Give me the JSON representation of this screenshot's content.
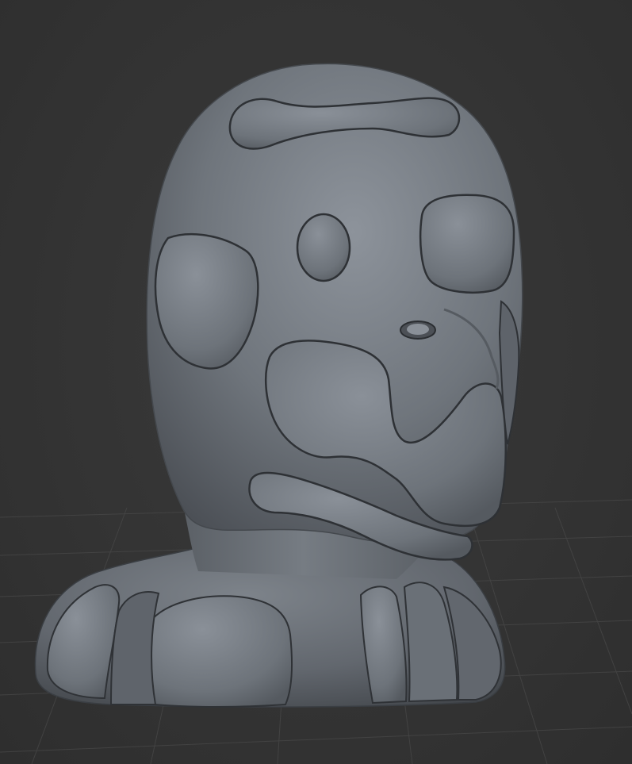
{
  "viewport": {
    "background_color": "#343434",
    "grid_color": "#4a4a4a",
    "model_base_color": "#6e737a",
    "model_highlight_color": "#9aa0a8",
    "model_shadow_color": "#3e4247"
  }
}
